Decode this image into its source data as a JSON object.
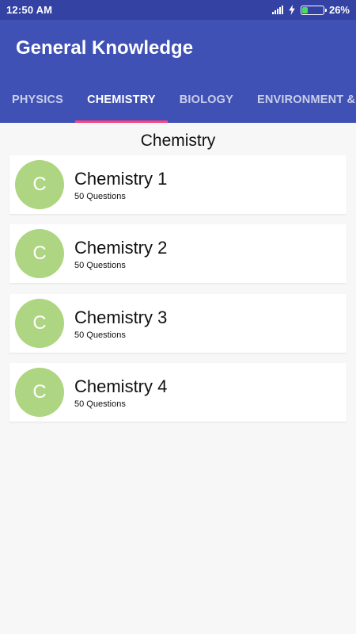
{
  "status_bar": {
    "time": "12:50 AM",
    "battery_percent": "26%",
    "battery_level": 0.26,
    "icons": [
      "signal-icon",
      "charging-icon",
      "battery-icon"
    ]
  },
  "app_bar": {
    "title": "General Knowledge",
    "tabs": [
      {
        "label": "PHYSICS",
        "active": false
      },
      {
        "label": "CHEMISTRY",
        "active": true
      },
      {
        "label": "BIOLOGY",
        "active": false
      },
      {
        "label": "ENVIRONMENT & EC",
        "active": false
      }
    ]
  },
  "main": {
    "section_title": "Chemistry",
    "items": [
      {
        "avatar_letter": "C",
        "title": "Chemistry 1",
        "subtitle": "50 Questions"
      },
      {
        "avatar_letter": "C",
        "title": "Chemistry 2",
        "subtitle": "50 Questions"
      },
      {
        "avatar_letter": "C",
        "title": "Chemistry 3",
        "subtitle": "50 Questions"
      },
      {
        "avatar_letter": "C",
        "title": "Chemistry 4",
        "subtitle": "50 Questions"
      }
    ]
  },
  "colors": {
    "status_bar": "#3443a3",
    "app_bar": "#3f51b5",
    "tab_indicator": "#ff4081",
    "avatar": "#aed581",
    "battery_fill": "#4cd964",
    "background": "#f7f7f7"
  }
}
